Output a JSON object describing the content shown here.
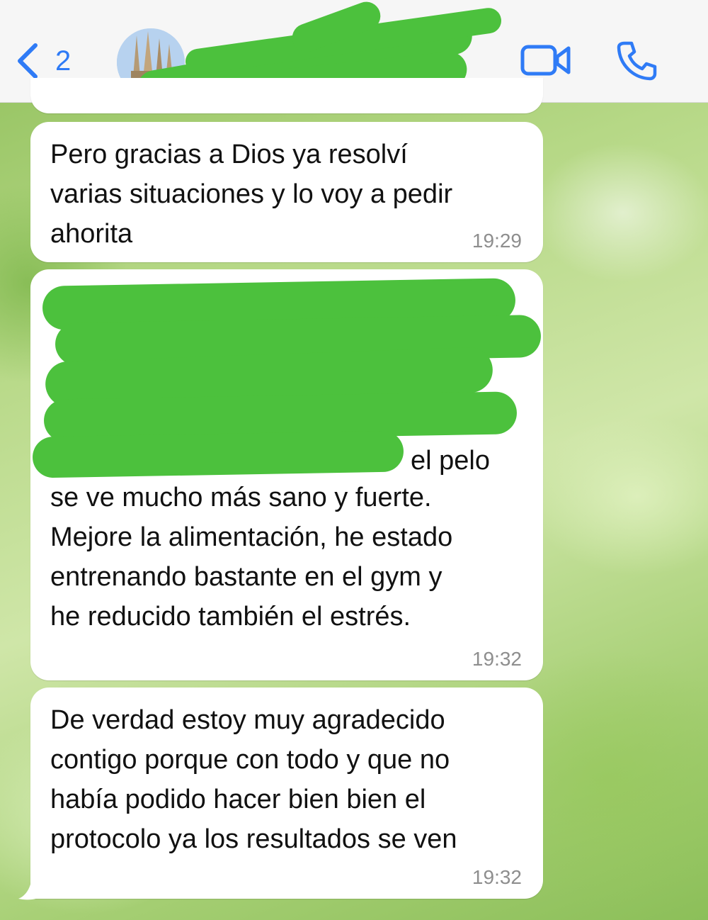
{
  "header": {
    "back_count": "2",
    "contact_name": ""
  },
  "messages": [
    {
      "text": "Pero gracias a Dios ya resolví\nvarias situaciones y lo voy a pedir\nahorita",
      "time": "19:29"
    },
    {
      "visible_text": "el pelo",
      "text": "se ve mucho más sano y fuerte.\nMejore la alimentación, he estado\nentrenando bastante en el gym y\nhe reducido también el estrés.",
      "time": "19:32"
    },
    {
      "text": "De verdad estoy muy agradecido\ncontigo porque con todo y que no\nhabía podido hacer bien bien el\nprotocolo ya los resultados se ven",
      "time": "19:32"
    }
  ],
  "colors": {
    "accent": "#2f7bf6",
    "redaction": "#4cc13d",
    "bubble": "#ffffff",
    "timestamp": "#8e8e8e"
  },
  "icons": {
    "back": "chevron-left-icon",
    "video": "video-camera-icon",
    "call": "phone-icon"
  }
}
